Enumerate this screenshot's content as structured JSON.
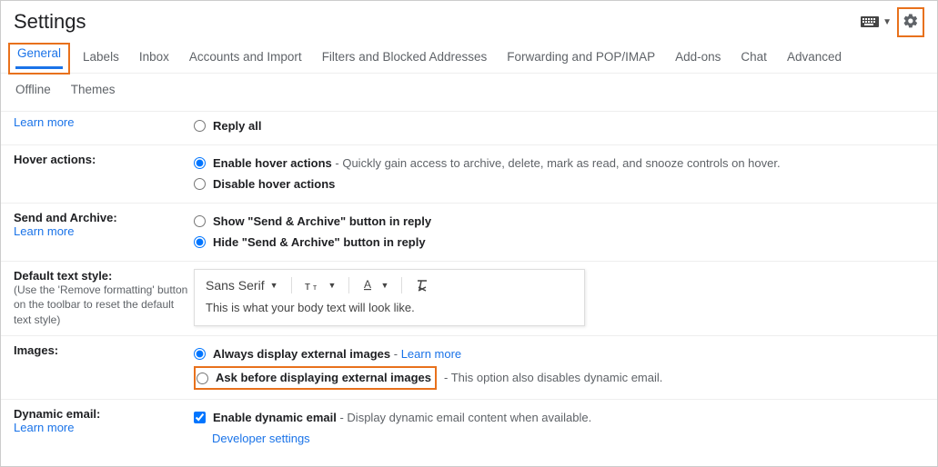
{
  "title": "Settings",
  "tabs": {
    "general": "General",
    "labels": "Labels",
    "inbox": "Inbox",
    "accounts": "Accounts and Import",
    "filters": "Filters and Blocked Addresses",
    "forwarding": "Forwarding and POP/IMAP",
    "addons": "Add-ons",
    "chat": "Chat",
    "advanced": "Advanced",
    "offline": "Offline",
    "themes": "Themes"
  },
  "learn_more": "Learn more",
  "reply": {
    "replyall": "Reply all"
  },
  "hover": {
    "label": "Hover actions:",
    "enable": "Enable hover actions",
    "enable_desc": "Quickly gain access to archive, delete, mark as read, and snooze controls on hover.",
    "disable": "Disable hover actions"
  },
  "sendarchive": {
    "label": "Send and Archive:",
    "show": "Show \"Send & Archive\" button in reply",
    "hide": "Hide \"Send & Archive\" button in reply"
  },
  "textstyle": {
    "label": "Default text style:",
    "sub": "(Use the 'Remove formatting' button on the toolbar to reset the default text style)",
    "font": "Sans Serif",
    "preview": "This is what your body text will look like."
  },
  "images": {
    "label": "Images:",
    "always": "Always display external images",
    "ask": "Ask before displaying external images",
    "ask_desc": "This option also disables dynamic email."
  },
  "dynamic": {
    "label": "Dynamic email:",
    "enable": "Enable dynamic email",
    "enable_desc": "Display dynamic email content when available.",
    "dev": "Developer settings"
  }
}
